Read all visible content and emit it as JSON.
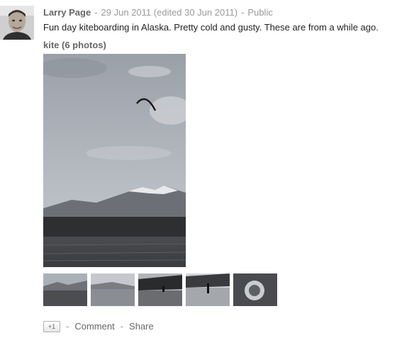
{
  "post": {
    "author": "Larry Page",
    "date": "29 Jun 2011",
    "edited": "(edited 30 Jun 2011)",
    "visibility": "Public",
    "separator": "-",
    "text": "Fun day kiteboarding in Alaska. Pretty cold and gusty. These are from a while ago."
  },
  "album": {
    "title": "kite (6 photos)"
  },
  "actions": {
    "plus_one": "+1",
    "separator": "-",
    "comment": "Comment",
    "share": "Share"
  }
}
